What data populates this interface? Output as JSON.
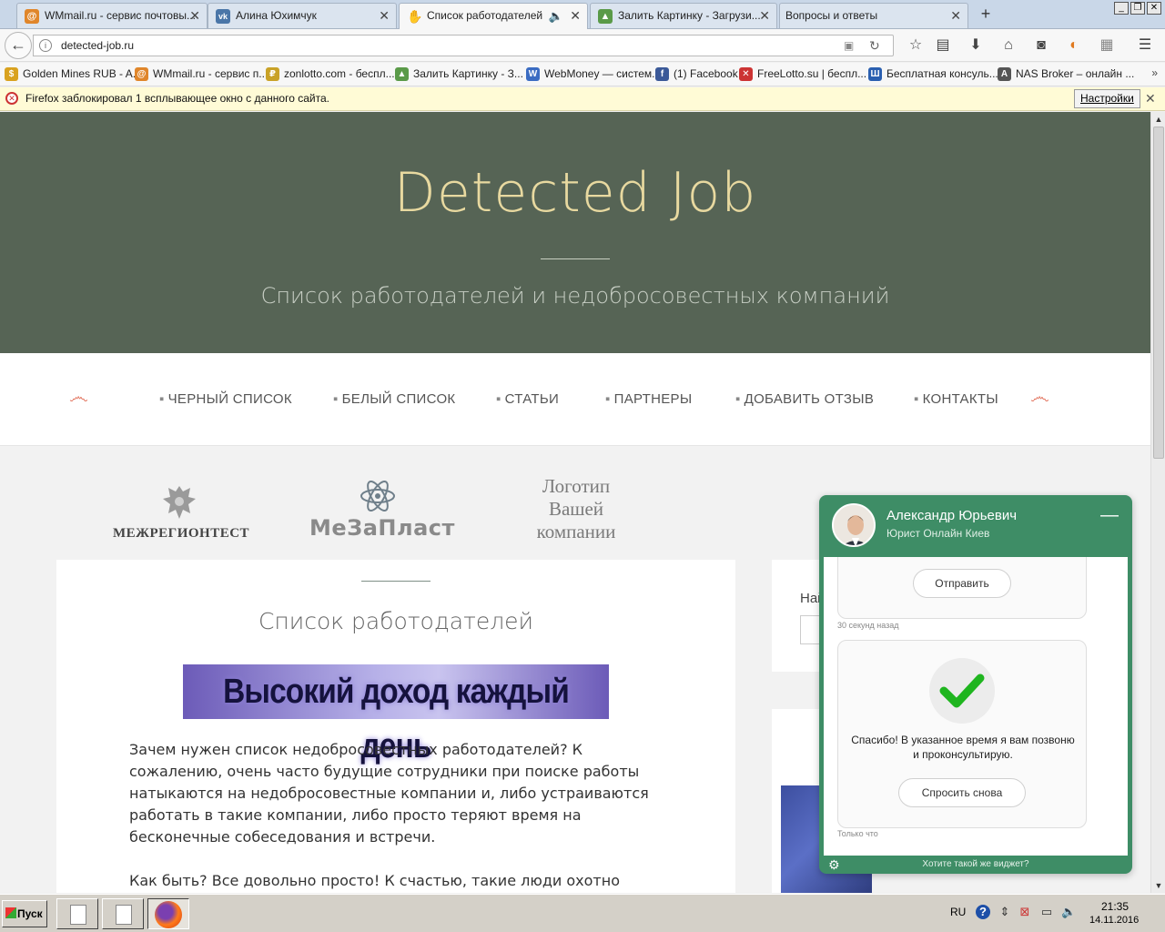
{
  "tabs": [
    {
      "title": "WMmail.ru - сервис почтовы...",
      "icon": "at-icon",
      "color": "#e0862b"
    },
    {
      "title": "Алина Юхимчук",
      "icon": "vk-icon",
      "color": "#4a76a8"
    },
    {
      "title": "Список работодателей",
      "icon": "hand-icon",
      "color": "#333333"
    },
    {
      "title": "Залить Картинку - Загрузи...",
      "icon": "image-icon",
      "color": "#5a9a48"
    },
    {
      "title": "Вопросы и ответы",
      "icon": "",
      "color": ""
    }
  ],
  "window_buttons": [
    "_",
    "❐",
    "✕"
  ],
  "url": "detected-job.ru",
  "bookmarks": [
    {
      "label": "Golden Mines RUB - A...",
      "color": "#d9a21f",
      "glyph": "$"
    },
    {
      "label": "WMmail.ru - сервис п...",
      "color": "#e0862b",
      "glyph": "@"
    },
    {
      "label": "zonlotto.com - беспл...",
      "color": "#c9a227",
      "glyph": "₽"
    },
    {
      "label": "Залить Картинку - З...",
      "color": "#5a9a48",
      "glyph": "▲"
    },
    {
      "label": "WebMoney — систем...",
      "color": "#3b6cc2",
      "glyph": "W"
    },
    {
      "label": "(1) Facebook",
      "color": "#3b5998",
      "glyph": "f"
    },
    {
      "label": "FreeLotto.su | беспл...",
      "color": "#cc3333",
      "glyph": "✕"
    },
    {
      "label": "Бесплатная консуль...",
      "color": "#2a5fb0",
      "glyph": "Ш"
    },
    {
      "label": "NAS Broker – онлайн ...",
      "color": "#555555",
      "glyph": "A"
    }
  ],
  "bookmarks_more": "»",
  "notification": {
    "text": "Firefox заблокировал 1 всплывающее окно с данного сайта.",
    "button": "Настройки"
  },
  "site": {
    "title": "Detected Job",
    "subtitle": "Список работодателей и недобросовестных компаний",
    "menu": [
      "ЧЕРНЫЙ СПИСОК",
      "БЕЛЫЙ СПИСОК",
      "СТАТЬИ",
      "ПАРТНЕРЫ",
      "ДОБАВИТЬ ОТЗЫВ",
      "КОНТАКТЫ"
    ],
    "menu_dot": "▪",
    "flourish": "෴",
    "logos": {
      "mrt": "МЕЖРЕГИОНТЕСТ",
      "mzp": "МеЗаПласт",
      "yours_l1": "Логотип",
      "yours_l2": "Вашей",
      "yours_l3": "компании"
    },
    "article": {
      "title": "Список работодателей",
      "banner": "Высокий доход каждый день",
      "p1": "Зачем нужен список недобросовестных работодателей? К сожалению, очень часто будущие сотрудники при поиске работы натыкаются на недобросовестные компании и, либо устраиваются работать в такие компании, либо просто теряют время на бесконечные собеседования и встречи.",
      "p2": "Как быть? Все довольно просто! К счастью, такие люди охотно делятся"
    },
    "sidebar_search_label": "Най"
  },
  "chat": {
    "name": "Александр Юрьевич",
    "role": "Юрист Онлайн Киев",
    "minimize": "—",
    "send_button": "Отправить",
    "time1": "30 секунд назад",
    "thanks": "Спасибо! В указанное время я вам позвоню и проконсультирую.",
    "ask_again": "Спросить снова",
    "time2": "Только что",
    "footer": "Хотите такой же виджет?"
  },
  "taskbar": {
    "start": "Пуск",
    "lang": "RU",
    "time": "21:35",
    "date": "14.11.2016"
  }
}
